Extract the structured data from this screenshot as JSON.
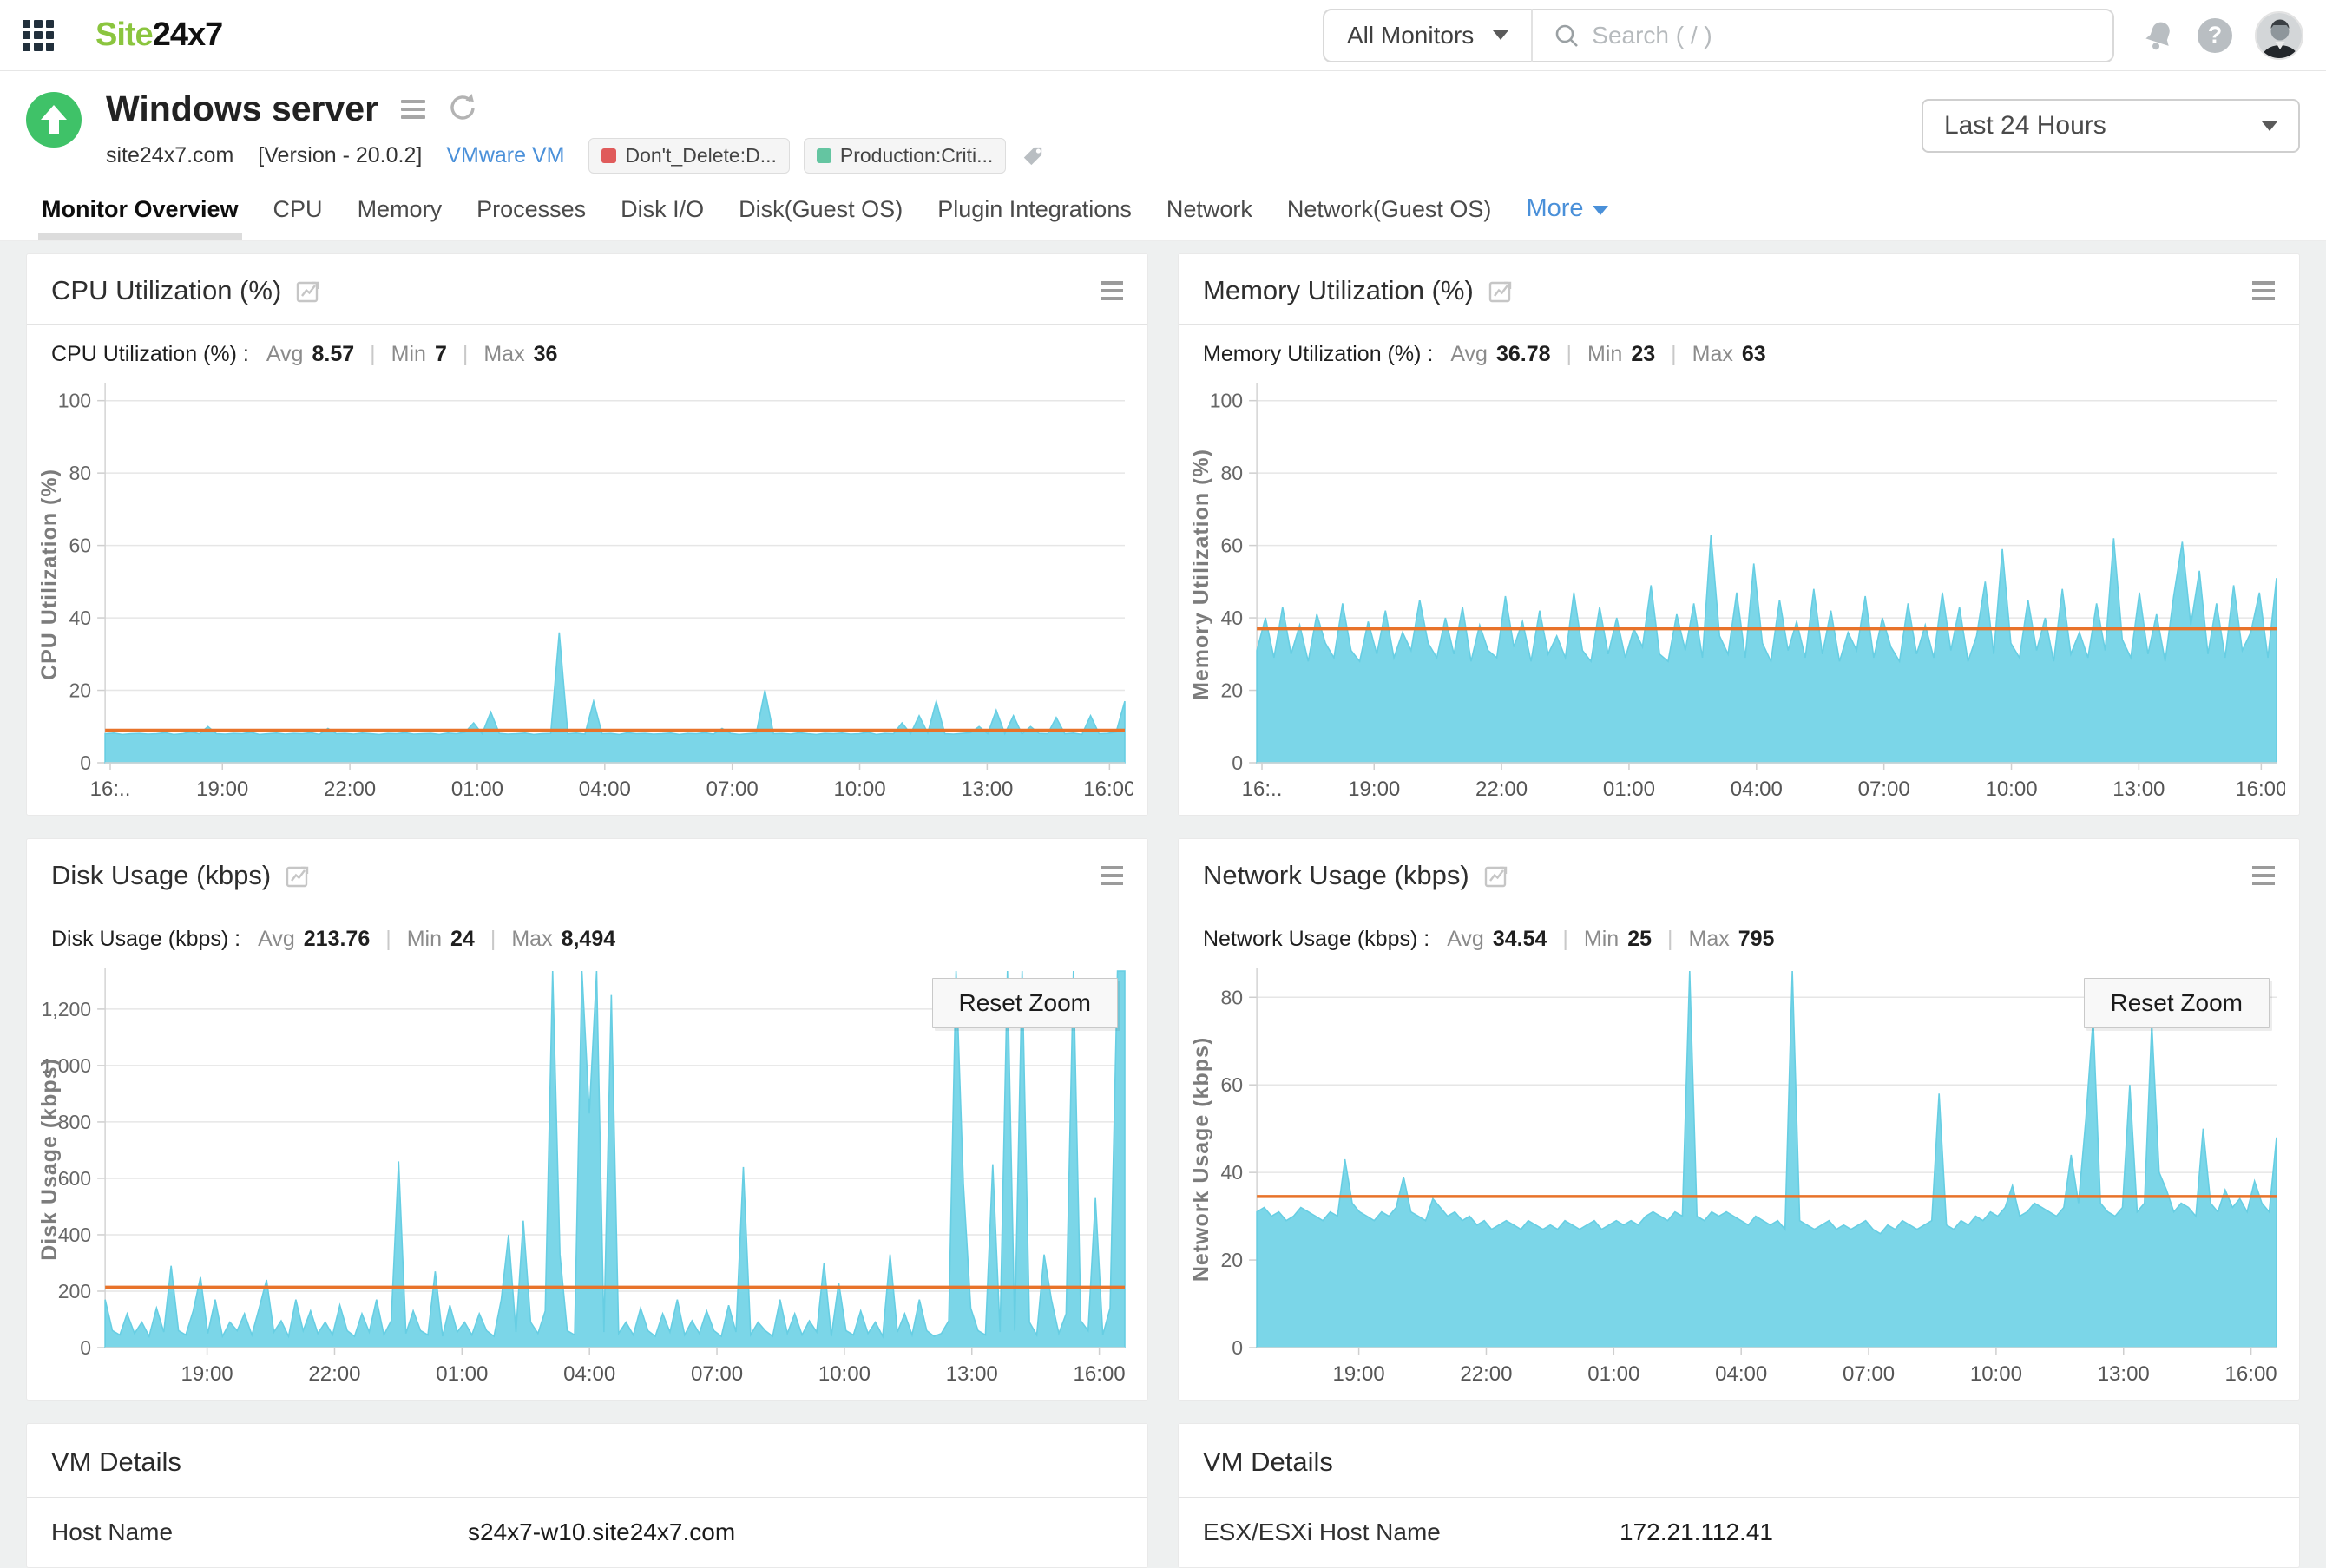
{
  "topbar": {
    "logo_site": "Site",
    "logo_24x7": "24x7",
    "monitor_scope": "All Monitors",
    "search_placeholder": "Search ( / )",
    "help_glyph": "?"
  },
  "header": {
    "title": "Windows server",
    "host": "site24x7.com",
    "version": "[Version - 20.0.2]",
    "vm_type_link": "VMware VM",
    "tags": [
      {
        "label": "Don't_Delete:D...",
        "color": "#e05b5b"
      },
      {
        "label": "Production:Criti...",
        "color": "#64c5a1"
      }
    ],
    "status_color": "#3fc268",
    "time_range": "Last 24 Hours"
  },
  "tabs": {
    "items": [
      "Monitor Overview",
      "CPU",
      "Memory",
      "Processes",
      "Disk I/O",
      "Disk(Guest OS)",
      "Plugin Integrations",
      "Network",
      "Network(Guest OS)"
    ],
    "active": "Monitor Overview",
    "more_label": "More"
  },
  "stats_labels": {
    "avg": "Avg",
    "min": "Min",
    "max": "Max"
  },
  "reset_zoom_label": "Reset Zoom",
  "panels": [
    {
      "title": "CPU Utilization (%)",
      "stats_label": "CPU Utilization (%) :",
      "avg": "8.57",
      "min": "7",
      "max": "36"
    },
    {
      "title": "Memory Utilization (%)",
      "stats_label": "Memory Utilization (%) :",
      "avg": "36.78",
      "min": "23",
      "max": "63"
    },
    {
      "title": "Disk Usage (kbps)",
      "stats_label": "Disk Usage (kbps) :",
      "avg": "213.76",
      "min": "24",
      "max": "8,494"
    },
    {
      "title": "Network Usage (kbps)",
      "stats_label": "Network Usage (kbps) :",
      "avg": "34.54",
      "min": "25",
      "max": "795"
    }
  ],
  "vm_details": [
    {
      "title": "VM Details",
      "rows": [
        {
          "label": "Host Name",
          "value": "s24x7-w10.site24x7.com"
        }
      ]
    },
    {
      "title": "VM Details",
      "rows": [
        {
          "label": "ESX/ESXi Host Name",
          "value": "172.21.112.41"
        }
      ]
    }
  ],
  "chart_data": [
    {
      "type": "area",
      "title": "CPU Utilization (%)",
      "ylabel": "CPU Utilization (%)",
      "plot_max": 104,
      "yticks": [
        0,
        20,
        40,
        60,
        80,
        100
      ],
      "ytick_labels": [
        "0",
        "20",
        "40",
        "60",
        "80",
        "100"
      ],
      "xlabels": [
        "16:..",
        "19:00",
        "22:00",
        "01:00",
        "04:00",
        "07:00",
        "10:00",
        "13:00",
        "16:00"
      ],
      "xpos": [
        0.005,
        0.115,
        0.24,
        0.365,
        0.49,
        0.615,
        0.74,
        0.865,
        0.985
      ],
      "avg_line": 9,
      "reset_zoom": false,
      "summary": {
        "avg": 8.57,
        "min": 7,
        "max": 36
      },
      "values": [
        8,
        8.2,
        7.8,
        8,
        8.1,
        7.9,
        8,
        8.3,
        7.8,
        8,
        8.5,
        8,
        10,
        8,
        7.9,
        8.1,
        8,
        8.4,
        7.8,
        8,
        8.2,
        7.9,
        8.1,
        8,
        8.3,
        7.8,
        9.5,
        8,
        8.1,
        7.9,
        8.2,
        8,
        7.8,
        8.1,
        8,
        8.3,
        7.9,
        8,
        8.1,
        7.8,
        8.2,
        8,
        8.4,
        11,
        8,
        14,
        8.1,
        7.9,
        8,
        8.2,
        7.8,
        8,
        8.1,
        36,
        8,
        8.2,
        7.9,
        17,
        8,
        8.1,
        7.8,
        8.3,
        8,
        8.1,
        7.9,
        8,
        8.2,
        7.8,
        8.1,
        8,
        8.3,
        7.9,
        9.5,
        8.1,
        7.8,
        8,
        8.2,
        20,
        8,
        8.1,
        7.9,
        8.3,
        8,
        7.8,
        8.1,
        8,
        8.2,
        7.9,
        8,
        8.4,
        7.8,
        8.1,
        8,
        11,
        8,
        13,
        8.2,
        17,
        8,
        7.9,
        8.1,
        8.3,
        10,
        8,
        14.5,
        8,
        13,
        7.9,
        10,
        8.1,
        8,
        12.5,
        8,
        8.2,
        7.8,
        13,
        8,
        8.1,
        8.5,
        17
      ]
    },
    {
      "type": "area",
      "title": "Memory Utilization (%)",
      "ylabel": "Memory Utilization (%)",
      "plot_max": 104,
      "yticks": [
        0,
        20,
        40,
        60,
        80,
        100
      ],
      "ytick_labels": [
        "0",
        "20",
        "40",
        "60",
        "80",
        "100"
      ],
      "xlabels": [
        "16:..",
        "19:00",
        "22:00",
        "01:00",
        "04:00",
        "07:00",
        "10:00",
        "13:00",
        "16:00"
      ],
      "xpos": [
        0.005,
        0.115,
        0.24,
        0.365,
        0.49,
        0.615,
        0.74,
        0.865,
        0.985
      ],
      "avg_line": 37,
      "reset_zoom": false,
      "summary": {
        "avg": 36.78,
        "min": 23,
        "max": 63
      },
      "values": [
        31,
        40,
        29,
        43,
        30,
        38,
        28,
        41,
        33,
        29,
        44,
        31,
        28,
        39,
        30,
        42,
        29,
        36,
        31,
        45,
        33,
        29,
        40,
        30,
        43,
        28,
        38,
        31,
        29,
        46,
        32,
        39,
        28,
        42,
        30,
        35,
        29,
        47,
        31,
        28,
        43,
        30,
        40,
        29,
        37,
        32,
        49,
        30,
        28,
        41,
        31,
        44,
        29,
        63,
        35,
        30,
        47,
        29,
        55,
        33,
        28,
        45,
        31,
        39,
        29,
        48,
        30,
        42,
        28,
        36,
        31,
        46,
        29,
        40,
        32,
        28,
        44,
        30,
        38,
        29,
        47,
        31,
        43,
        28,
        35,
        50,
        30,
        59,
        33,
        29,
        45,
        31,
        40,
        28,
        48,
        30,
        36,
        29,
        44,
        31,
        62,
        34,
        29,
        47,
        30,
        41,
        28,
        46,
        61,
        38,
        53,
        30,
        44,
        29,
        49,
        31,
        36,
        47,
        29,
        51
      ]
    },
    {
      "type": "area",
      "title": "Disk Usage (kbps)",
      "ylabel": "Disk Usage (kbps)",
      "plot_max": 1335,
      "yticks": [
        0,
        200,
        400,
        600,
        800,
        1000,
        1200
      ],
      "ytick_labels": [
        "0",
        "200",
        "400",
        "600",
        "800",
        "1,000",
        "1,200"
      ],
      "xlabels": [
        "19:00",
        "22:00",
        "01:00",
        "04:00",
        "07:00",
        "10:00",
        "13:00",
        "16:00"
      ],
      "xpos": [
        0.1,
        0.225,
        0.35,
        0.475,
        0.6,
        0.725,
        0.85,
        0.975
      ],
      "avg_line": 214,
      "reset_zoom": true,
      "summary": {
        "avg": 213.76,
        "min": 24,
        "max": 8494
      },
      "values": [
        170,
        60,
        45,
        120,
        50,
        90,
        40,
        140,
        55,
        290,
        60,
        45,
        130,
        250,
        50,
        170,
        40,
        90,
        60,
        120,
        45,
        140,
        240,
        55,
        95,
        40,
        170,
        60,
        130,
        50,
        90,
        45,
        150,
        60,
        40,
        120,
        55,
        170,
        45,
        95,
        660,
        50,
        130,
        60,
        45,
        270,
        40,
        150,
        55,
        90,
        45,
        120,
        60,
        40,
        170,
        400,
        55,
        450,
        90,
        50,
        130,
        8494,
        330,
        60,
        45,
        8494,
        830,
        8494,
        55,
        1250,
        50,
        90,
        45,
        140,
        60,
        40,
        120,
        55,
        170,
        45,
        95,
        50,
        130,
        60,
        40,
        150,
        55,
        640,
        45,
        90,
        60,
        40,
        170,
        50,
        120,
        45,
        95,
        55,
        300,
        40,
        230,
        60,
        45,
        130,
        50,
        90,
        40,
        330,
        55,
        120,
        45,
        170,
        60,
        40,
        50,
        95,
        8494,
        580,
        140,
        60,
        45,
        650,
        55,
        8494,
        60,
        8494,
        90,
        45,
        330,
        170,
        50,
        120,
        8494,
        95,
        60,
        530,
        45,
        140,
        8494,
        8494
      ]
    },
    {
      "type": "area",
      "title": "Network Usage (kbps)",
      "ylabel": "Network Usage (kbps)",
      "plot_max": 86,
      "yticks": [
        0,
        20,
        40,
        60,
        80
      ],
      "ytick_labels": [
        "0",
        "20",
        "40",
        "60",
        "80"
      ],
      "xlabels": [
        "19:00",
        "22:00",
        "01:00",
        "04:00",
        "07:00",
        "10:00",
        "13:00",
        "16:00"
      ],
      "xpos": [
        0.1,
        0.225,
        0.35,
        0.475,
        0.6,
        0.725,
        0.85,
        0.975
      ],
      "avg_line": 34.5,
      "reset_zoom": true,
      "summary": {
        "avg": 34.54,
        "min": 25,
        "max": 795
      },
      "values": [
        31,
        32,
        30,
        31,
        29,
        30,
        32,
        31,
        30,
        29,
        31,
        30,
        43,
        33,
        31,
        30,
        29,
        31,
        30,
        32,
        39,
        31,
        30,
        29,
        34,
        32,
        30,
        31,
        29,
        30,
        28,
        29,
        27,
        28,
        29,
        28,
        27,
        29,
        28,
        27,
        28,
        27,
        29,
        28,
        27,
        28,
        29,
        27,
        28,
        29,
        28,
        29,
        28,
        30,
        31,
        30,
        29,
        31,
        30,
        795,
        30,
        29,
        31,
        30,
        31,
        30,
        29,
        28,
        30,
        29,
        28,
        29,
        27,
        795,
        29,
        28,
        27,
        28,
        29,
        27,
        28,
        27,
        28,
        29,
        27,
        26,
        28,
        27,
        29,
        28,
        27,
        28,
        29,
        58,
        28,
        27,
        29,
        28,
        30,
        29,
        31,
        30,
        32,
        37,
        30,
        31,
        33,
        32,
        31,
        30,
        32,
        44,
        33,
        52,
        75,
        33,
        31,
        30,
        32,
        60,
        31,
        33,
        74,
        40,
        36,
        31,
        33,
        32,
        30,
        50,
        33,
        31,
        36,
        32,
        34,
        31,
        38,
        33,
        31,
        48
      ]
    }
  ],
  "chart_style": {
    "series_fill": "#7bd6e8",
    "series_stroke": "#67cee3",
    "avg_color": "#e8732a",
    "grid_color": "#e6e6e6"
  }
}
